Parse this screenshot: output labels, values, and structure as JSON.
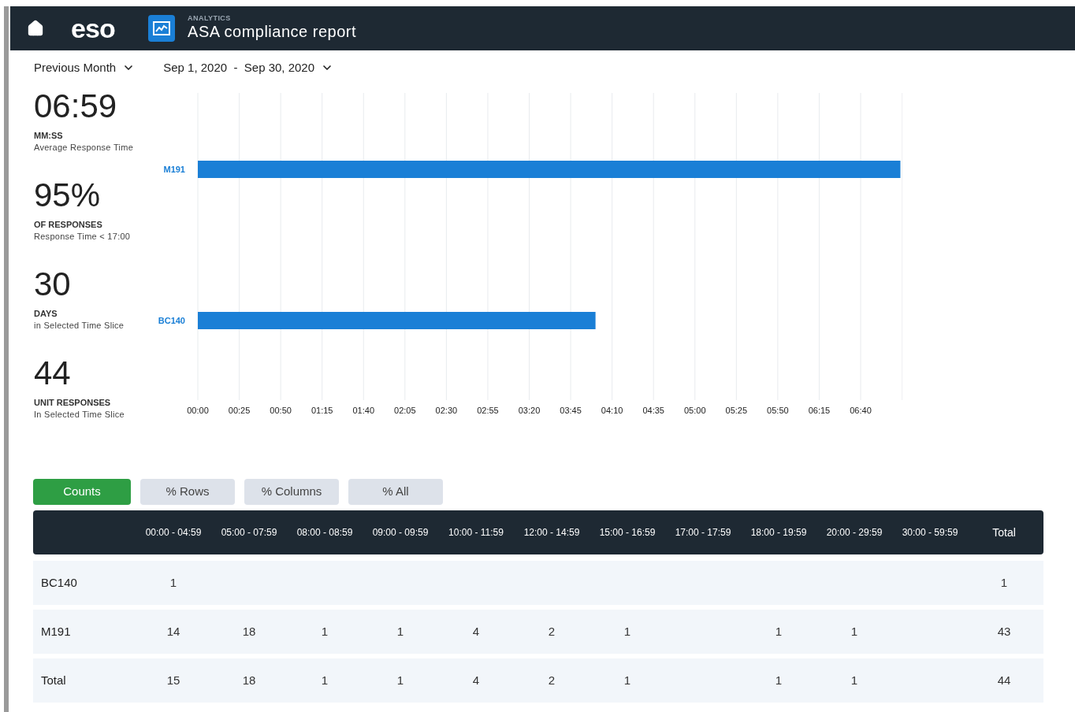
{
  "header": {
    "logo": "eso",
    "section": "ANALYTICS",
    "title": "ASA compliance report"
  },
  "filters": [
    {
      "label": "Previous Month"
    },
    {
      "label": "Sep 1, 2020  -  Sep 30, 2020"
    }
  ],
  "stats": [
    {
      "value": "06:59",
      "unit": "MM:SS",
      "caption": "Average Response Time"
    },
    {
      "value": "95%",
      "unit": "OF RESPONSES",
      "caption": "Response Time < 17:00"
    },
    {
      "value": "30",
      "unit": "DAYS",
      "caption": "in Selected Time Slice"
    },
    {
      "value": "44",
      "unit": "UNIT RESPONSES",
      "caption": "In Selected Time Slice"
    }
  ],
  "chart": {
    "chart_data": {
      "type": "bar",
      "orientation": "horizontal",
      "categories": [
        "M191",
        "BC140"
      ],
      "series": [
        {
          "color": "#1a7fd6",
          "values": [
            424,
            240
          ]
        }
      ],
      "grid": true,
      "xlim": [
        0,
        425
      ],
      "xticks": [
        {
          "value": 0,
          "label": "00:00"
        },
        {
          "value": 25,
          "label": "00:25"
        },
        {
          "value": 50,
          "label": "00:50"
        },
        {
          "value": 75,
          "label": "01:15"
        },
        {
          "value": 100,
          "label": "01:40"
        },
        {
          "value": 125,
          "label": "02:05"
        },
        {
          "value": 150,
          "label": "02:30"
        },
        {
          "value": 175,
          "label": "02:55"
        },
        {
          "value": 200,
          "label": "03:20"
        },
        {
          "value": 225,
          "label": "03:45"
        },
        {
          "value": 250,
          "label": "04:10"
        },
        {
          "value": 275,
          "label": "04:35"
        },
        {
          "value": 300,
          "label": "05:00"
        },
        {
          "value": 325,
          "label": "05:25"
        },
        {
          "value": 350,
          "label": "05:50"
        },
        {
          "value": 375,
          "label": "06:15"
        },
        {
          "value": 400,
          "label": "06:40"
        }
      ]
    }
  },
  "view_buttons": [
    {
      "label": "Counts",
      "selected": true
    },
    {
      "label": "% Rows",
      "selected": false
    },
    {
      "label": "% Columns",
      "selected": false
    },
    {
      "label": "% All",
      "selected": false
    }
  ],
  "table": {
    "columns": [
      "",
      "00:00 - 04:59",
      "05:00 - 07:59",
      "08:00 - 08:59",
      "09:00 - 09:59",
      "10:00 - 11:59",
      "12:00 - 14:59",
      "15:00 - 16:59",
      "17:00 - 17:59",
      "18:00 - 19:59",
      "20:00 - 29:59",
      "30:00 - 59:59",
      "Total"
    ],
    "rows": [
      {
        "cells": [
          "BC140",
          "1",
          "",
          "",
          "",
          "",
          "",
          "",
          "",
          "",
          "",
          "",
          "1"
        ]
      },
      {
        "cells": [
          "M191",
          "14",
          "18",
          "1",
          "1",
          "4",
          "2",
          "1",
          "",
          "1",
          "1",
          "",
          "43"
        ]
      },
      {
        "cells": [
          "Total",
          "15",
          "18",
          "1",
          "1",
          "4",
          "2",
          "1",
          "",
          "1",
          "1",
          "",
          "44"
        ]
      }
    ]
  }
}
